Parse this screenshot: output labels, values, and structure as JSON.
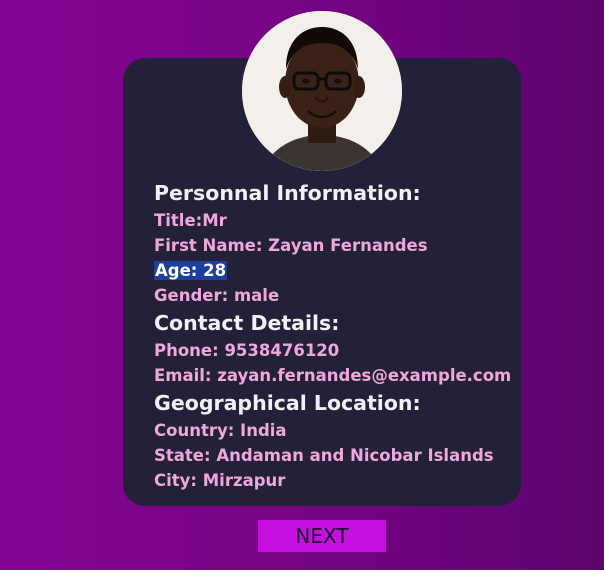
{
  "profile": {
    "photo_icon": "person-photo-icon"
  },
  "personal": {
    "heading": "Personnal Information:",
    "title": "Title:Mr",
    "first_name": "First Name: Zayan Fernandes",
    "age": "Age: 28",
    "gender": "Gender: male"
  },
  "contact": {
    "heading": "Contact Details:",
    "phone": "Phone: 9538476120",
    "email": "Email: zayan.fernandes@example.com"
  },
  "location": {
    "heading": "Geographical Location:",
    "country": "Country: India",
    "state": "State: Andaman and Nicobar Islands",
    "city": "City: Mirzapur"
  },
  "actions": {
    "next_label": "NEXT"
  },
  "colors": {
    "card_background": "#232039",
    "field_text": "#f0a7d9",
    "heading_text": "#f2f0f5",
    "selection_highlight": "#1d3f9e",
    "next_button": "#c60fe0"
  }
}
